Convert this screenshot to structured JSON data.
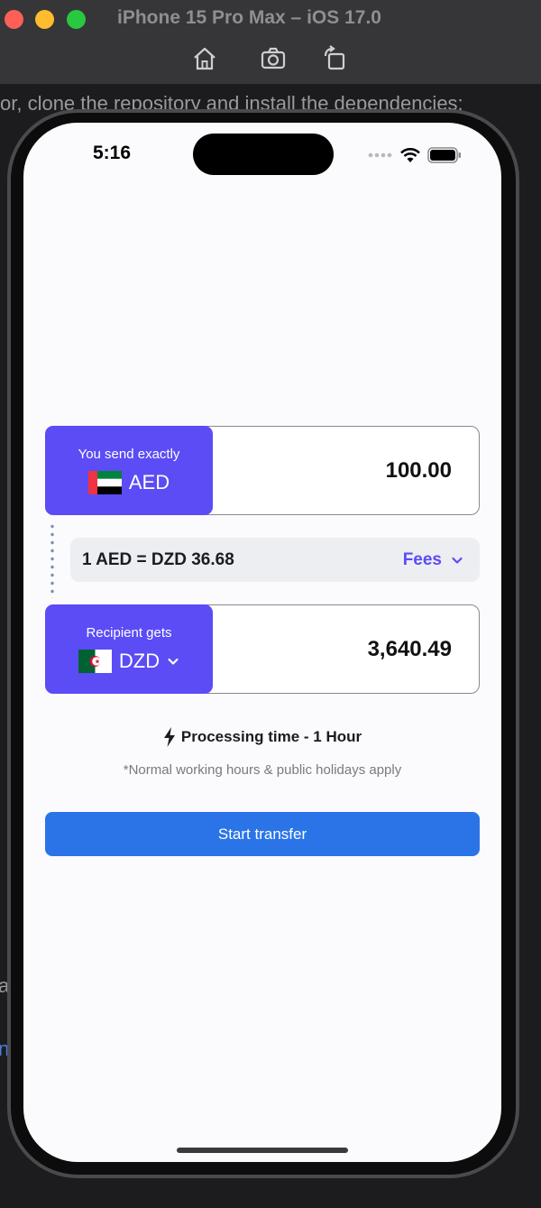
{
  "window": {
    "title": "iPhone 15 Pro Max – iOS 17.0",
    "toolbar_icons": [
      "home-icon",
      "screenshot-icon",
      "rotate-icon"
    ]
  },
  "background": {
    "doc_line": "or, clone the repository and install the dependencies:",
    "letter_a": "a",
    "letter_n": "n"
  },
  "status_bar": {
    "time": "5:16",
    "icons": [
      "signal-dots-icon",
      "wifi-icon",
      "battery-icon"
    ]
  },
  "send": {
    "label": "You send exactly",
    "currency": "AED",
    "amount": "100.00",
    "flag": "uae-flag-icon"
  },
  "rate": {
    "text": "1 AED = DZD 36.68",
    "fees_label": "Fees"
  },
  "receive": {
    "label": "Recipient gets",
    "currency": "DZD",
    "amount": "3,640.49",
    "flag": "algeria-flag-icon"
  },
  "processing": {
    "text": "Processing time - 1 Hour",
    "note": "*Normal working hours & public holidays apply"
  },
  "cta": {
    "label": "Start transfer"
  },
  "colors": {
    "accent": "#5b4cf5",
    "primary_button": "#2b74e8",
    "rate_bar_bg": "#eceef2",
    "screen_bg": "#fbfafd"
  }
}
